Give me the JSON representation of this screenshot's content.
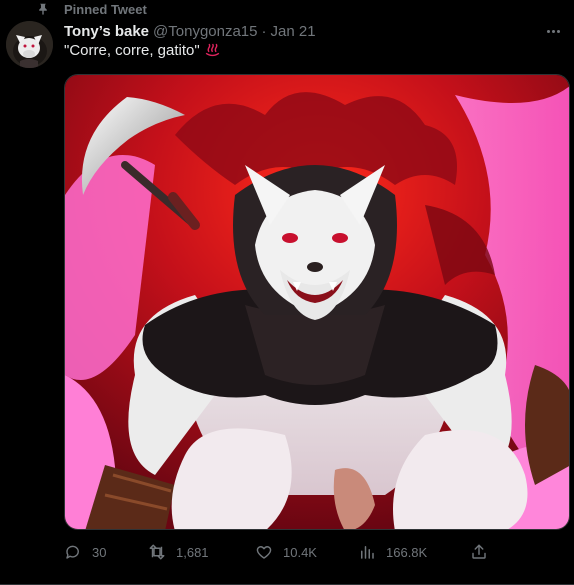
{
  "pinned": {
    "label": "Pinned Tweet",
    "icon": "pin-icon"
  },
  "author": {
    "display_name": "Tony’s bake",
    "handle": "@Tonygonza15",
    "separator": "·",
    "date": "Jan 21"
  },
  "tweet": {
    "text": "\"Corre, corre, gatito\"",
    "emoji_icon": "hot-springs-icon"
  },
  "media": {
    "icon": "artwork-image"
  },
  "actions": {
    "reply_count": "30",
    "retweet_count": "1,681",
    "like_count": "10.4K",
    "view_count": "166.8K"
  },
  "colors": {
    "background": "#000000",
    "primary_text": "#e7e9ea",
    "secondary_text": "#71767b",
    "emoji_red": "#e0245e"
  }
}
